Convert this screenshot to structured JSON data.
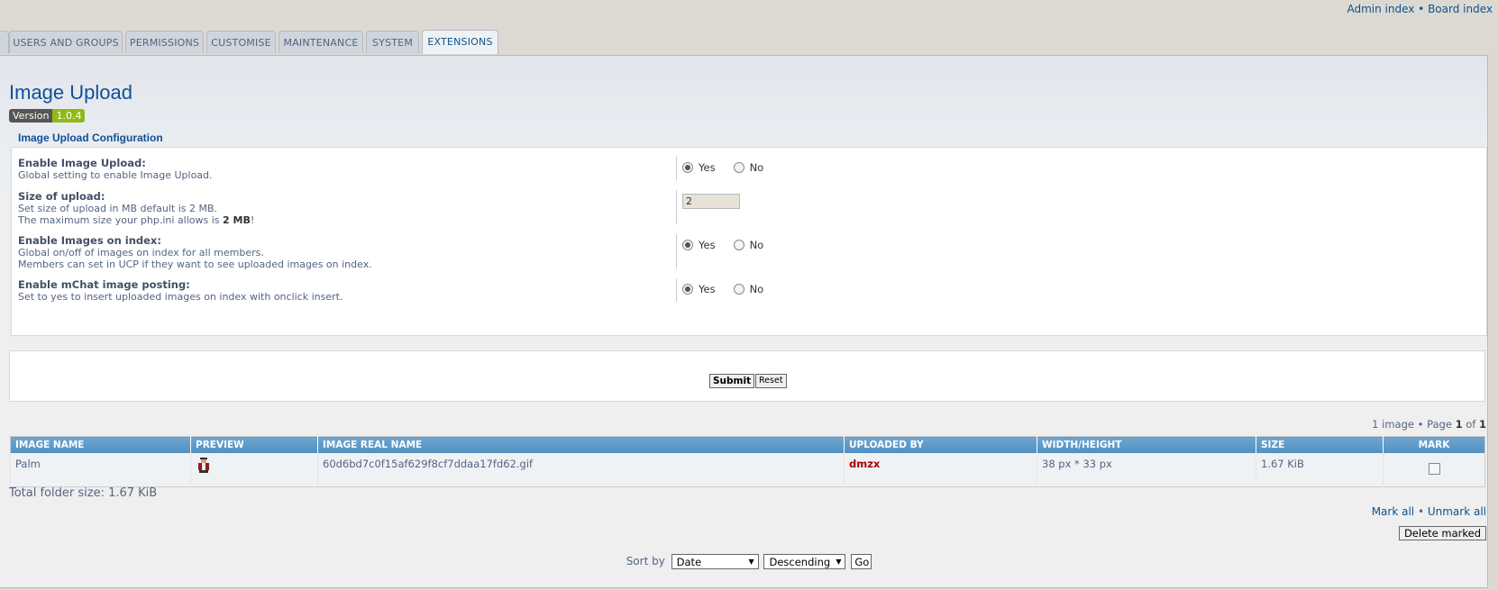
{
  "toplinks": {
    "admin_index": "Admin index",
    "separator": " • ",
    "board_index": "Board index"
  },
  "tabs": [
    {
      "label": "USERS AND GROUPS"
    },
    {
      "label": "PERMISSIONS"
    },
    {
      "label": "CUSTOMISE"
    },
    {
      "label": "MAINTENANCE"
    },
    {
      "label": "SYSTEM"
    },
    {
      "label": "EXTENSIONS",
      "active": true
    }
  ],
  "page": {
    "title": "Image Upload",
    "version_label": "Version",
    "version_number": "1.0.4"
  },
  "config": {
    "legend": "Image Upload Configuration",
    "enable_upload": {
      "label": "Enable Image Upload:",
      "desc": "Global setting to enable Image Upload.",
      "yes": "Yes",
      "no": "No",
      "value": "yes"
    },
    "size_upload": {
      "label": "Size of upload:",
      "desc1": "Set size of upload in MB default is 2 MB.",
      "desc2_pre": "The maximum size your php.ini allows is ",
      "desc2_bold": "2 MB",
      "desc2_post": "!",
      "value": "2"
    },
    "enable_index": {
      "label": "Enable Images on index:",
      "desc1": "Global on/off of images on index for all members.",
      "desc2": "Members can set in UCP if they want to see uploaded images on index.",
      "yes": "Yes",
      "no": "No",
      "value": "yes"
    },
    "enable_mchat": {
      "label": "Enable mChat image posting:",
      "desc": "Set to yes to insert uploaded images on index with onclick insert.",
      "yes": "Yes",
      "no": "No",
      "value": "yes"
    }
  },
  "actions": {
    "submit": "Submit",
    "reset": "Reset"
  },
  "pagination": {
    "count": "1 image",
    "sep": " • Page ",
    "page": "1",
    "of": " of ",
    "total": "1"
  },
  "table": {
    "headers": [
      "IMAGE NAME",
      "PREVIEW",
      "IMAGE REAL NAME",
      "UPLOADED BY",
      "WIDTH/HEIGHT",
      "SIZE",
      "MARK"
    ],
    "rows": [
      {
        "name": "Palm",
        "real_name": "60d6bd7c0f15af629f8cf7ddaa17fd62.gif",
        "uploaded_by": "dmzx",
        "dimensions": "38 px * 33 px",
        "size": "1.67 KiB"
      }
    ]
  },
  "footer": {
    "total_size": "Total folder size: 1.67 KiB",
    "mark_all": "Mark all",
    "mark_sep": " • ",
    "unmark_all": "Unmark all",
    "delete_marked": "Delete marked",
    "sort_by": "Sort by",
    "sort_key": "Date",
    "sort_dir": "Descending",
    "go": "Go"
  },
  "colors": {
    "accent": "#105289",
    "uploader": "#aa0000",
    "version_bg": "#8eb916",
    "table_header": "#5090c2"
  }
}
